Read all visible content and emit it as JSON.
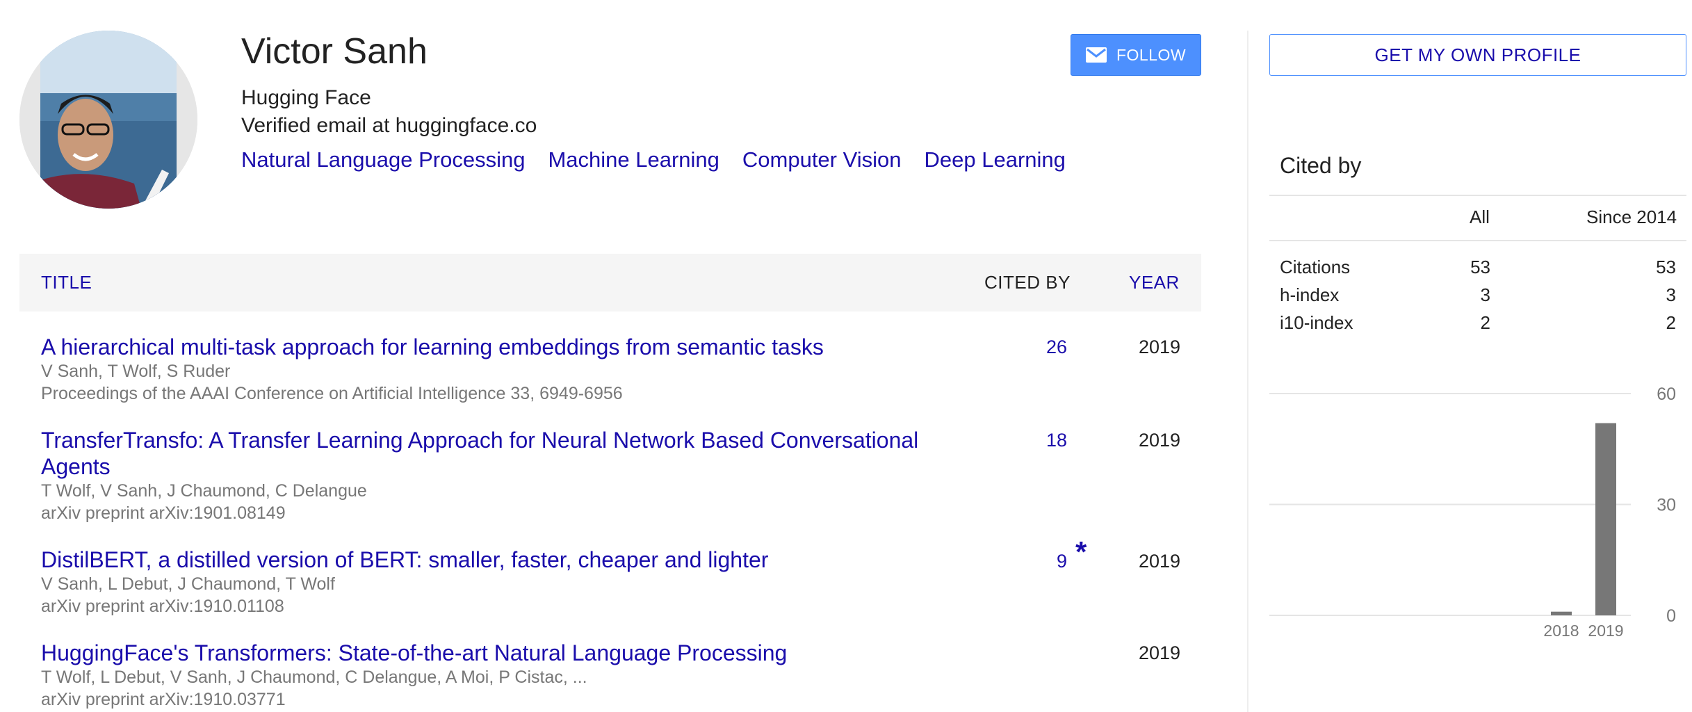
{
  "profile": {
    "name": "Victor Sanh",
    "affiliation": "Hugging Face",
    "email": "Verified email at huggingface.co",
    "interests": [
      "Natural Language Processing",
      "Machine Learning",
      "Computer Vision",
      "Deep Learning"
    ],
    "follow_label": "FOLLOW"
  },
  "table": {
    "headers": {
      "title": "TITLE",
      "cited_by": "CITED BY",
      "year": "YEAR"
    },
    "rows": [
      {
        "title": "A hierarchical multi-task approach for learning embeddings from semantic tasks",
        "authors": "V Sanh, T Wolf, S Ruder",
        "venue": "Proceedings of the AAAI Conference on Artificial Intelligence 33, 6949-6956",
        "cited_by": "26",
        "year": "2019"
      },
      {
        "title": "TransferTransfo: A Transfer Learning Approach for Neural Network Based Conversational Agents",
        "authors": "T Wolf, V Sanh, J Chaumond, C Delangue",
        "venue": "arXiv preprint arXiv:1901.08149",
        "cited_by": "18",
        "year": "2019"
      },
      {
        "title": "DistilBERT, a distilled version of BERT: smaller, faster, cheaper and lighter",
        "authors": "V Sanh, L Debut, J Chaumond, T Wolf",
        "venue": "arXiv preprint arXiv:1910.01108",
        "cited_by": "9",
        "star": "*",
        "year": "2019"
      },
      {
        "title": "HuggingFace's Transformers: State-of-the-art Natural Language Processing",
        "authors": "T Wolf, L Debut, V Sanh, J Chaumond, C Delangue, A Moi, P Cistac, ...",
        "venue": "arXiv preprint arXiv:1910.03771",
        "cited_by": "",
        "year": "2019"
      }
    ]
  },
  "sidebar": {
    "own_profile_label": "GET MY OWN PROFILE",
    "cited_by_title": "Cited by",
    "columns": {
      "all": "All",
      "since": "Since 2014"
    },
    "stats": [
      {
        "label": "Citations",
        "all": "53",
        "since": "53"
      },
      {
        "label": "h-index",
        "all": "3",
        "since": "3"
      },
      {
        "label": "i10-index",
        "all": "2",
        "since": "2"
      }
    ]
  },
  "chart_data": {
    "type": "bar",
    "categories": [
      "2018",
      "2019"
    ],
    "values": [
      1,
      52
    ],
    "yticks": [
      0,
      30,
      60
    ],
    "ylim": [
      0,
      60
    ],
    "bar_color": "#777777",
    "grid": true
  },
  "colors": {
    "link": "#1a0dab",
    "button": "#4d90fe",
    "header_bg": "#f5f5f5"
  }
}
